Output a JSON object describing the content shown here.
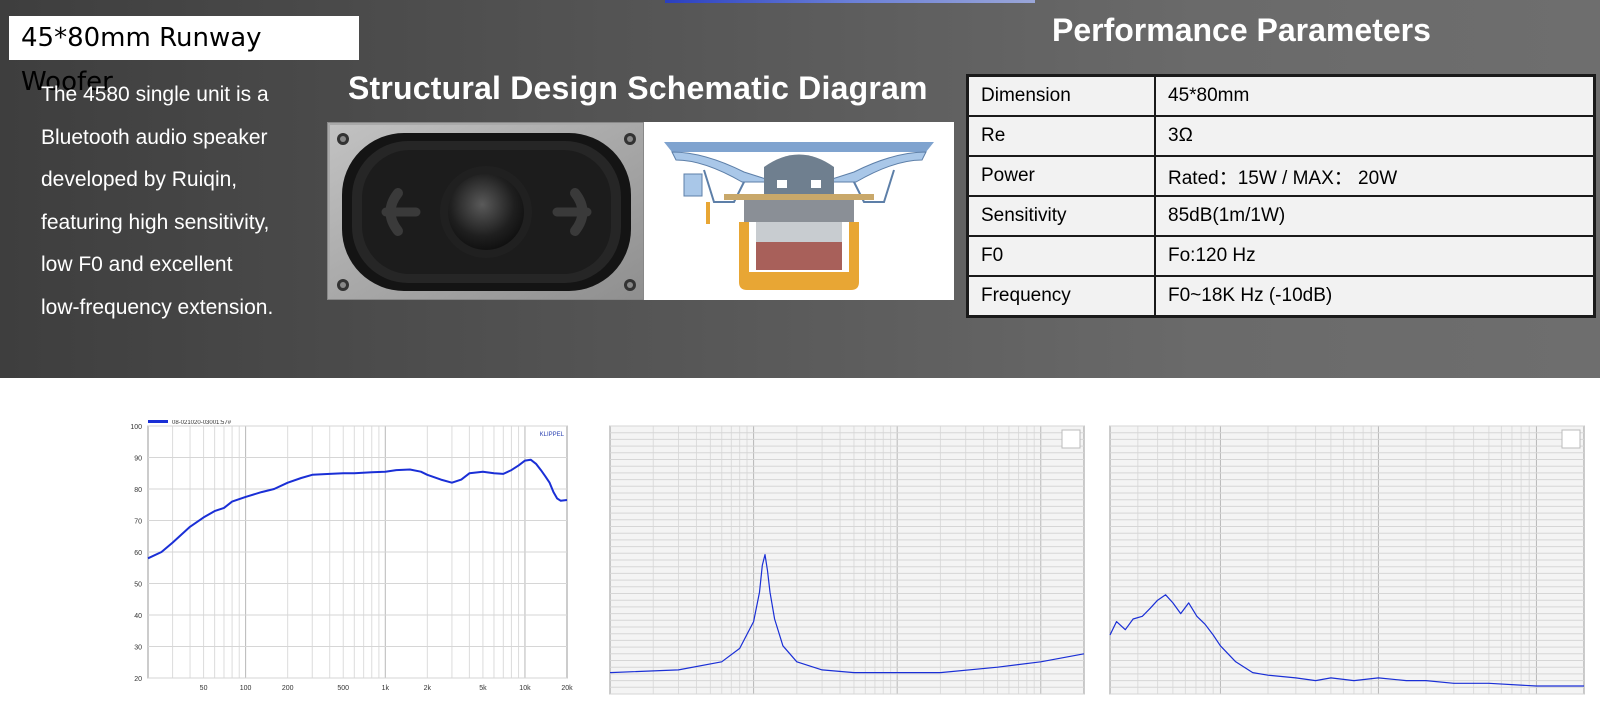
{
  "banner": {
    "product_title": "45*80mm Runway Woofer",
    "intro_lines": [
      "The 4580 single unit is a",
      "Bluetooth audio speaker",
      "developed by Ruiqin,",
      "featuring high sensitivity,",
      "low F0 and excellent",
      "low-frequency extension."
    ],
    "diagram_title": "Structural Design Schematic Diagram",
    "performance_title": "Performance Parameters"
  },
  "parameters": [
    {
      "key": "Dimension",
      "value": "45*80mm"
    },
    {
      "key": "Re",
      "value": "3Ω"
    },
    {
      "key": "Power",
      "value": "Rated：15W / MAX：  20W"
    },
    {
      "key": "Sensitivity",
      "value": "85dB(1m/1W)"
    },
    {
      "key": "F0",
      "value": "Fo:120 Hz"
    },
    {
      "key": "Frequency",
      "value": "F0~18K Hz  (-10dB)"
    }
  ],
  "colors": {
    "curve_blue": "#1a2fd6",
    "cone_blue": "#a9c7e8",
    "magnet_orange": "#e8a634",
    "coil_red": "#a8605a"
  },
  "chart_data": [
    {
      "type": "line",
      "legend": "08-021020-03001:57#",
      "brand": "KLIPPEL",
      "x_scale": "log",
      "xlim": [
        20,
        20000
      ],
      "ylim": [
        20,
        100
      ],
      "x_ticks": [
        "50",
        "100",
        "200",
        "500",
        "1k",
        "2k",
        "5k",
        "10k",
        "20k"
      ],
      "y_ticks": [
        "100",
        "90",
        "80",
        "70",
        "60",
        "50",
        "40",
        "30",
        "20"
      ],
      "grid": true,
      "series": [
        {
          "name": "08-021020-03001:57#",
          "x": [
            20,
            25,
            30,
            40,
            50,
            60,
            70,
            80,
            100,
            130,
            160,
            200,
            250,
            300,
            400,
            500,
            600,
            800,
            1000,
            1200,
            1500,
            1800,
            2000,
            2500,
            3000,
            3500,
            4000,
            5000,
            6000,
            7000,
            8000,
            9000,
            10000,
            11000,
            12000,
            13000,
            14000,
            15000,
            16000,
            17000,
            18000,
            20000
          ],
          "y": [
            58,
            60,
            63,
            68,
            71,
            73,
            74,
            76,
            77.5,
            79,
            80,
            82,
            83.5,
            84.5,
            84.8,
            85,
            85,
            85.3,
            85.5,
            86,
            86.2,
            85.5,
            84.5,
            83,
            82,
            83,
            85,
            85.5,
            85,
            84.8,
            86,
            87.5,
            89,
            89.3,
            88,
            86,
            84,
            82,
            79,
            77,
            76.3,
            76.5
          ]
        }
      ]
    },
    {
      "type": "line",
      "x_scale": "log",
      "xlim": [
        10,
        20000
      ],
      "ylim": [
        0,
        100
      ],
      "grid": true,
      "series": [
        {
          "x": [
            10,
            30,
            60,
            80,
            100,
            110,
            115,
            120,
            125,
            130,
            140,
            160,
            200,
            300,
            500,
            1000,
            2000,
            5000,
            10000,
            20000
          ],
          "y": [
            8,
            9,
            12,
            17,
            27,
            38,
            48,
            52,
            46,
            38,
            28,
            18,
            12,
            9,
            8,
            8,
            8,
            10,
            12,
            15
          ]
        }
      ]
    },
    {
      "type": "line",
      "x_scale": "log",
      "xlim": [
        20,
        20000
      ],
      "ylim": [
        0,
        100
      ],
      "grid": true,
      "series": [
        {
          "x": [
            20,
            22,
            25,
            28,
            32,
            36,
            40,
            45,
            50,
            56,
            63,
            71,
            80,
            90,
            100,
            125,
            160,
            200,
            300,
            400,
            500,
            700,
            1000,
            1500,
            2000,
            3000,
            5000,
            10000,
            20000
          ],
          "y": [
            22,
            27,
            24,
            28,
            29,
            32,
            35,
            37,
            34,
            30,
            34,
            29,
            26,
            22,
            18,
            12,
            8,
            7,
            6,
            5,
            6,
            5,
            6,
            5,
            5,
            4,
            4,
            3,
            3
          ]
        }
      ]
    }
  ]
}
